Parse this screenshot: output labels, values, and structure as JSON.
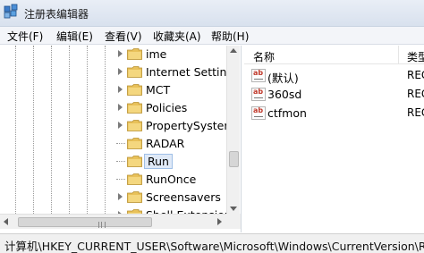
{
  "window": {
    "title": "注册表编辑器"
  },
  "menu": [
    "文件(F)",
    "编辑(E)",
    "查看(V)",
    "收藏夹(A)",
    "帮助(H)"
  ],
  "tree": {
    "items": [
      {
        "label": "ime",
        "expandable": true
      },
      {
        "label": "Internet Settings",
        "expandable": true
      },
      {
        "label": "MCT",
        "expandable": true
      },
      {
        "label": "Policies",
        "expandable": true
      },
      {
        "label": "PropertySystem",
        "expandable": true
      },
      {
        "label": "RADAR",
        "expandable": false
      },
      {
        "label": "Run",
        "expandable": false,
        "selected": true
      },
      {
        "label": "RunOnce",
        "expandable": false
      },
      {
        "label": "Screensavers",
        "expandable": true
      },
      {
        "label": "Shell Extensions",
        "expandable": true
      }
    ]
  },
  "values": {
    "columns": {
      "name": "名称",
      "type": "类型"
    },
    "rows": [
      {
        "name": "(默认)",
        "type": "REG",
        "icon": "string-value-icon"
      },
      {
        "name": "360sd",
        "type": "REG",
        "icon": "string-value-icon"
      },
      {
        "name": "ctfmon",
        "type": "REG",
        "icon": "string-value-icon"
      }
    ]
  },
  "status": {
    "path": "计算机\\HKEY_CURRENT_USER\\Software\\Microsoft\\Windows\\CurrentVersion\\Run"
  },
  "colors": {
    "folder": "#e8c15a",
    "selection": "#dfe9f7",
    "value_icon_text": "#c0392b"
  }
}
